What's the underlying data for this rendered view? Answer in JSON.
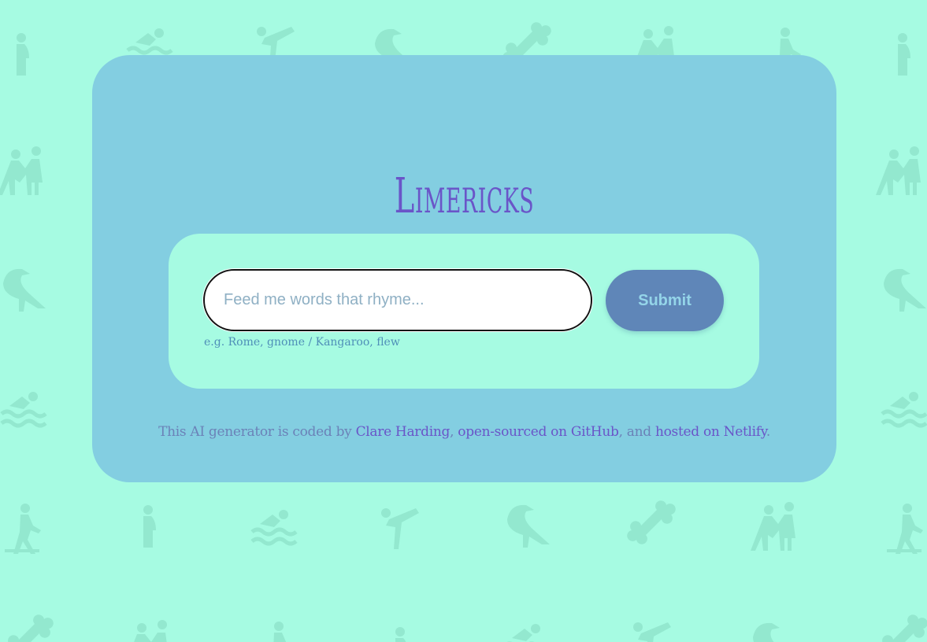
{
  "page": {
    "title": "Limericks"
  },
  "form": {
    "input_placeholder": "Feed me words that rhyme...",
    "input_value": "",
    "submit_label": "Submit",
    "hint": "e.g. Rome, gnome / Kangaroo, flew"
  },
  "credits": {
    "prefix": "This AI generator is coded by ",
    "author_link": "Clare Harding",
    "sep1": ", ",
    "github_link": "open-sourced on GitHub",
    "sep2": ", and ",
    "netlify_link": "hosted on Netlify",
    "suffix": "."
  },
  "background": {
    "pattern_icons": [
      "pregnant-person-icon",
      "swimmer-icon",
      "martial-arts-icon",
      "bird-icon",
      "bone-icon",
      "elder-care-icon",
      "hiker-icon"
    ]
  },
  "colors": {
    "page_bg": "#a6fbe2",
    "card_bg": "#83cee1",
    "title": "#6a55c8",
    "button_bg": "#5f86b8",
    "button_text": "#94d5e9",
    "link": "#6a55c8",
    "pattern": "#93e8cf"
  }
}
